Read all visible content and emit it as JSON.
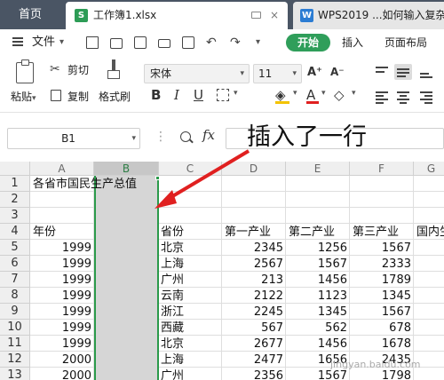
{
  "tabbar": {
    "home_label": "首页",
    "doc_icon_letter": "S",
    "doc_title": "工作簿1.xlsx",
    "close_glyph": "×",
    "doc2_icon_letter": "W",
    "doc2_title": "WPS2019 ...如何输入复杂"
  },
  "menu": {
    "file_label": "文件",
    "caret": "▾",
    "undo_glyph": "↶",
    "redo_glyph": "↷",
    "start_tab": "开始",
    "insert_tab": "插入",
    "layout_tab": "页面布局"
  },
  "ribbon": {
    "paste_label": "粘贴",
    "cut_label": "剪切",
    "copy_label": "复制",
    "format_painter_label": "格式刷",
    "cut_glyph": "✂",
    "font_name": "宋体",
    "font_size": "11",
    "bold": "B",
    "italic": "I",
    "underline": "U",
    "font_color_glyph": "A",
    "fill_glyph": "◈",
    "clear_glyph": "◇",
    "inc_font": "A⁺",
    "dec_font": "A⁻",
    "fill_color": "#f3c300",
    "font_color": "#e02020"
  },
  "formula": {
    "cell_ref": "B1",
    "fx": "fx",
    "dots": "⋮"
  },
  "columns": [
    "A",
    "B",
    "C",
    "D",
    "E",
    "F",
    "G"
  ],
  "selected_column": "B",
  "rows": [
    "1",
    "2",
    "3",
    "4",
    "5",
    "6",
    "7",
    "8",
    "9",
    "10",
    "11",
    "12",
    "13"
  ],
  "cells": {
    "title": "各省市国民生产总值",
    "header_year": "年份",
    "header_province": "省份",
    "header_primary": "第一产业",
    "header_secondary": "第二产业",
    "header_tertiary": "第三产业",
    "header_gdp": "国内生"
  },
  "data_rows": [
    {
      "year": "1999",
      "province": "北京",
      "primary": "2345",
      "secondary": "1256",
      "tertiary": "1567"
    },
    {
      "year": "1999",
      "province": "上海",
      "primary": "2567",
      "secondary": "1567",
      "tertiary": "2333"
    },
    {
      "year": "1999",
      "province": "广州",
      "primary": "213",
      "secondary": "1456",
      "tertiary": "1789"
    },
    {
      "year": "1999",
      "province": "云南",
      "primary": "2122",
      "secondary": "1123",
      "tertiary": "1345"
    },
    {
      "year": "1999",
      "province": "浙江",
      "primary": "2245",
      "secondary": "1345",
      "tertiary": "1567"
    },
    {
      "year": "1999",
      "province": "西藏",
      "primary": "567",
      "secondary": "562",
      "tertiary": "678"
    },
    {
      "year": "1999",
      "province": "北京",
      "primary": "2677",
      "secondary": "1456",
      "tertiary": "1678"
    },
    {
      "year": "2000",
      "province": "上海",
      "primary": "2477",
      "secondary": "1656",
      "tertiary": "2435"
    },
    {
      "year": "2000",
      "province": "广州",
      "primary": "2356",
      "secondary": "1567",
      "tertiary": "1798"
    }
  ],
  "annotation": {
    "text": "插入了一行",
    "color": "#e02020"
  },
  "accent_green": "#2b9a4a",
  "watermark": "jingyan.baidu.com"
}
